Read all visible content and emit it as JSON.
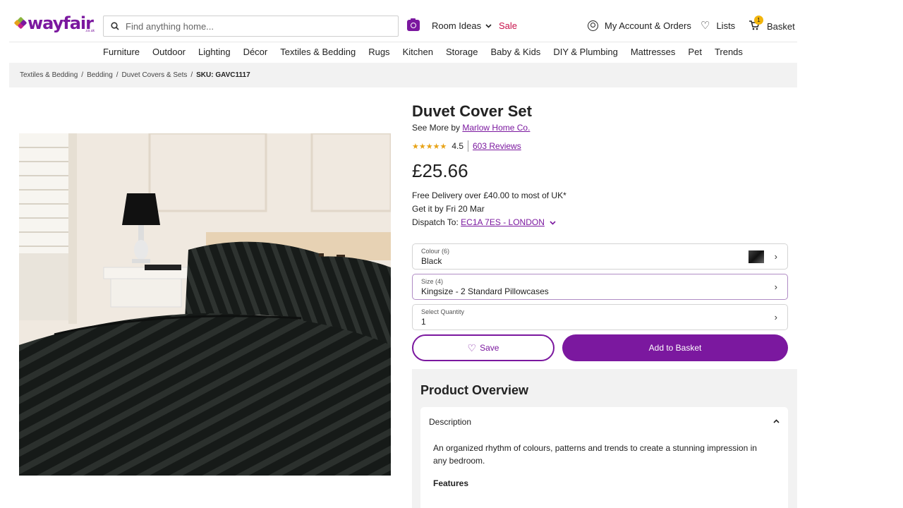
{
  "header": {
    "logo": "wayfair",
    "logo_sub": ".co.uk",
    "search_placeholder": "Find anything home...",
    "room_ideas": "Room Ideas",
    "sale": "Sale",
    "account": "My Account & Orders",
    "lists": "Lists",
    "basket": "Basket",
    "basket_count": "1"
  },
  "nav": [
    "Furniture",
    "Outdoor",
    "Lighting",
    "Décor",
    "Textiles & Bedding",
    "Rugs",
    "Kitchen",
    "Storage",
    "Baby & Kids",
    "DIY & Plumbing",
    "Mattresses",
    "Pet",
    "Trends"
  ],
  "breadcrumb": {
    "items": [
      "Textiles & Bedding",
      "Bedding",
      "Duvet Covers & Sets"
    ],
    "sku": "SKU: GAVC1117"
  },
  "product": {
    "title": "Duvet Cover Set",
    "see_more": "See More by",
    "brand": "Marlow Home Co.",
    "rating": "4.5",
    "rating_value": 4.5,
    "reviews": "603 Reviews",
    "price": "£25.66",
    "delivery_line": "Free Delivery over £40.00 to most of UK*",
    "get_by": "Get it by Fri 20 Mar",
    "dispatch_label": "Dispatch To:",
    "postcode": "EC1A 7ES - LONDON"
  },
  "options": {
    "colour_label": "Colour (6)",
    "colour_value": "Black",
    "size_label": "Size (4)",
    "size_value": "Kingsize - 2 Standard Pillowcases",
    "qty_label": "Select Quantity",
    "qty_value": "1"
  },
  "actions": {
    "save": "Save",
    "add_to_basket": "Add to Basket"
  },
  "overview": {
    "title": "Product Overview",
    "description_heading": "Description",
    "description_text": "An organized rhythm of colours, patterns and trends to create a stunning impression in any bedroom.",
    "features_heading": "Features"
  },
  "colors": {
    "brand": "#7b189f",
    "sale": "#c7114a",
    "star": "#e8a317",
    "badge": "#f2b50c"
  }
}
